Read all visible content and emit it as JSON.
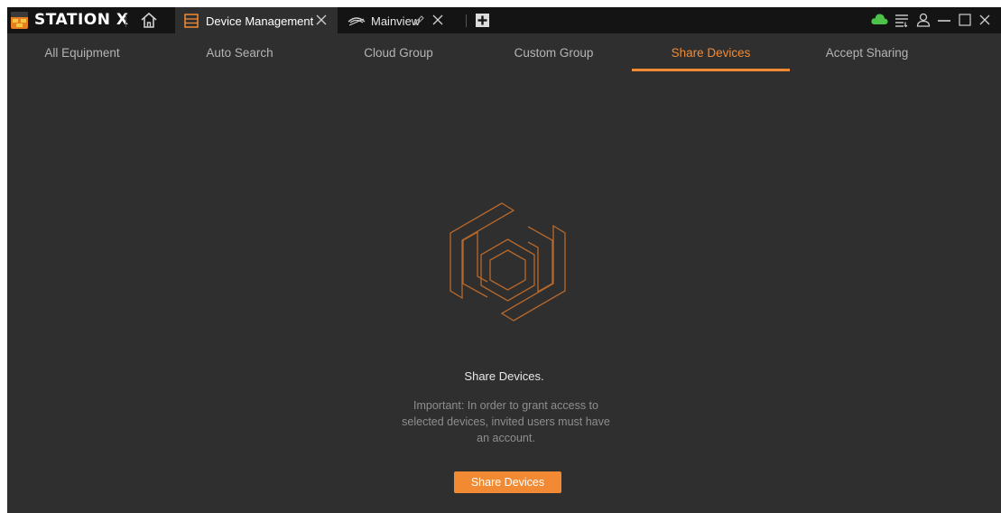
{
  "app": {
    "brand": "STATION X"
  },
  "tabs": [
    {
      "label": "Device Management",
      "icon": "list-icon",
      "active": true
    },
    {
      "label": "Mainview",
      "icon": "eye-icon",
      "active": false
    }
  ],
  "subnav": [
    {
      "label": "All Equipment"
    },
    {
      "label": "Auto Search"
    },
    {
      "label": "Cloud Group"
    },
    {
      "label": "Custom Group"
    },
    {
      "label": "Share Devices",
      "active": true
    },
    {
      "label": "Accept Sharing"
    }
  ],
  "content": {
    "title": "Share Devices.",
    "note_lines": [
      "Important: In order to grant access to",
      "selected devices, invited users must have",
      "an account."
    ],
    "button": "Share Devices"
  },
  "colors": {
    "accent": "#f28a33",
    "cloud": "#4cc24a",
    "background": "#2f2f2f",
    "titlebar": "#141414"
  }
}
